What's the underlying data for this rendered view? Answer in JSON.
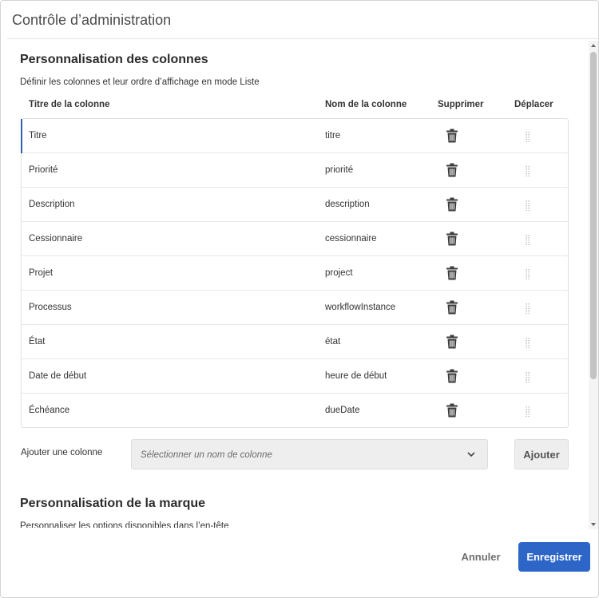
{
  "dialog": {
    "title": "Contrôle d’administration"
  },
  "columns_section": {
    "title": "Personnalisation des colonnes",
    "description": "Définir les colonnes et leur ordre d’affichage en mode Liste",
    "headers": {
      "column_title": "Titre de la colonne",
      "column_name": "Nom de la colonne",
      "delete": "Supprimer",
      "move": "Déplacer"
    },
    "rows": [
      {
        "title": "Titre",
        "name": "titre"
      },
      {
        "title": "Priorité",
        "name": "priorité"
      },
      {
        "title": "Description",
        "name": "description"
      },
      {
        "title": "Cessionnaire",
        "name": "cessionnaire"
      },
      {
        "title": "Projet",
        "name": "project"
      },
      {
        "title": "Processus",
        "name": "workflowInstance"
      },
      {
        "title": "État",
        "name": "état"
      },
      {
        "title": "Date de début",
        "name": "heure de début"
      },
      {
        "title": "Échéance",
        "name": "dueDate"
      }
    ],
    "add_column_label": "Ajouter une colonne",
    "select_placeholder": "Sélectionner un nom de colonne",
    "add_button": "Ajouter"
  },
  "branding_section": {
    "title": "Personnalisation de la marque",
    "description": "Personnaliser les options disponibles dans l’en-tête"
  },
  "footer": {
    "cancel_label": "Annuler",
    "save_label": "Enregistrer"
  },
  "colors": {
    "primary": "#2d66c6",
    "selected_row_indicator": "#2f5fb3"
  },
  "icons": {
    "delete": "trash-icon",
    "move": "drag-handle-icon",
    "dropdown": "chevron-down-icon"
  }
}
